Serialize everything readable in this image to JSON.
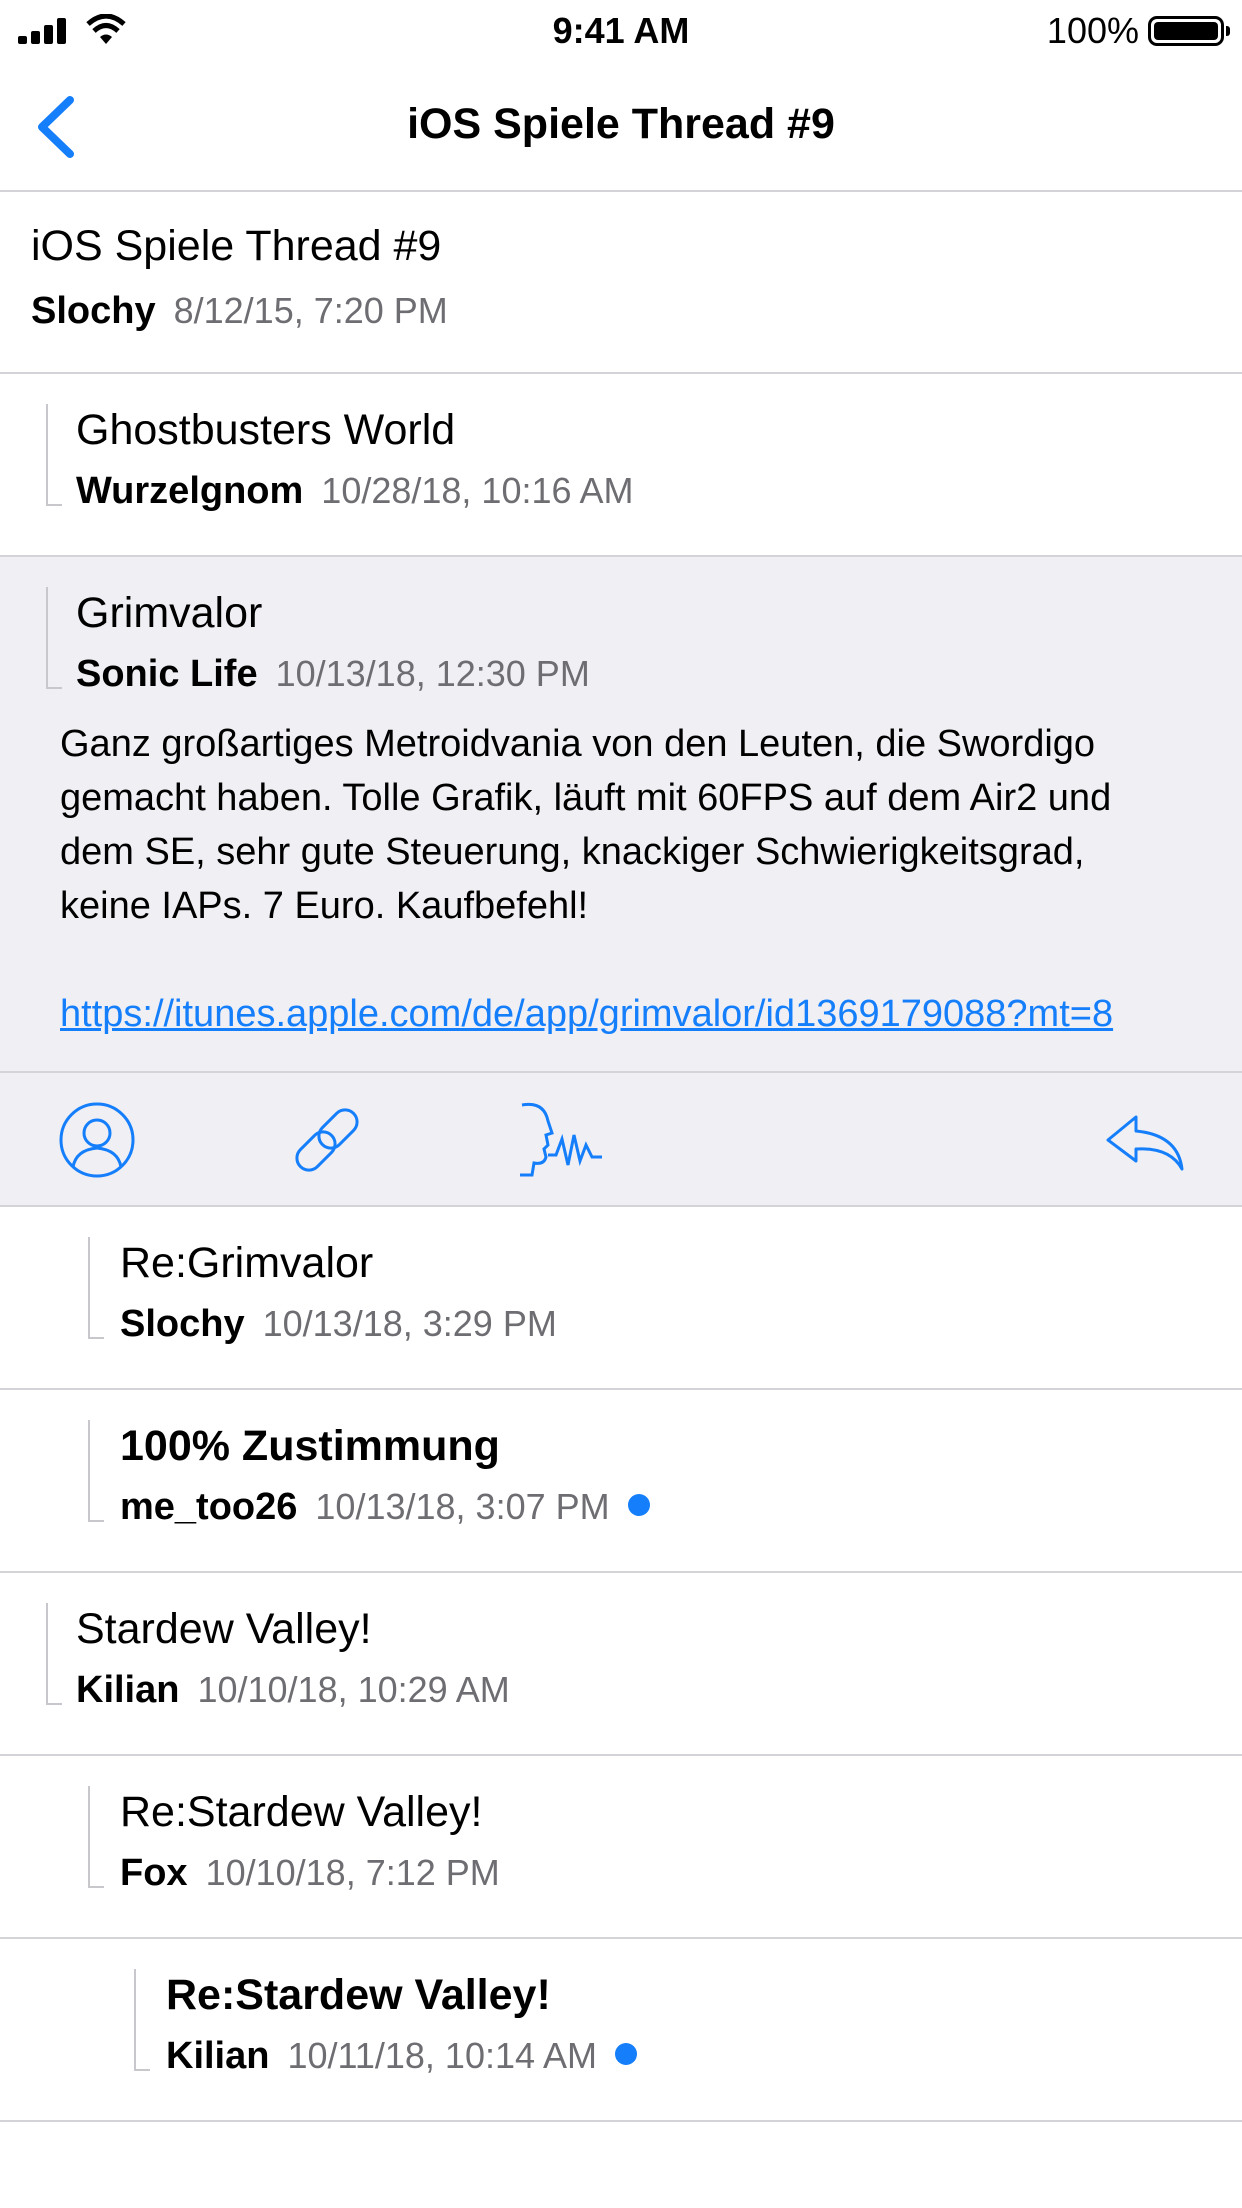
{
  "status_bar": {
    "time": "9:41 AM",
    "battery": "100%"
  },
  "nav": {
    "title": "iOS Spiele Thread #9",
    "back_icon": "chevron-left-icon"
  },
  "colors": {
    "accent": "#147efb",
    "separator": "#d4d4d8",
    "expanded_bg": "#efeff4",
    "secondary_text": "#6d6d72"
  },
  "root_post": {
    "title": "iOS Spiele Thread #9",
    "author": "Slochy",
    "date": "8/12/15, 7:20 PM"
  },
  "posts": [
    {
      "title": "Ghostbusters World",
      "author": "Wurzelgnom",
      "date": "10/28/18, 10:16 AM",
      "unread": false,
      "bold": false
    },
    {
      "title": "Grimvalor",
      "author": "Sonic Life",
      "date": "10/13/18, 12:30 PM",
      "expanded": true
    },
    {
      "title": "Re:Grimvalor",
      "author": "Slochy",
      "date": "10/13/18, 3:29 PM",
      "unread": false,
      "bold": false
    },
    {
      "title": "100% Zustimmung",
      "author": "me_too26",
      "date": "10/13/18, 3:07 PM",
      "unread": true,
      "bold": true
    },
    {
      "title": "Stardew Valley!",
      "author": "Kilian",
      "date": "10/10/18, 10:29 AM",
      "unread": false,
      "bold": false
    },
    {
      "title": "Re:Stardew Valley!",
      "author": "Fox",
      "date": "10/10/18, 7:12 PM",
      "unread": false,
      "bold": false
    },
    {
      "title": "Re:Stardew Valley!",
      "author": "Kilian",
      "date": "10/11/18, 10:14 AM",
      "unread": true,
      "bold": true
    }
  ],
  "expanded_post": {
    "body": "Ganz großartiges Metroidvania von den Leuten, die Swordigo gemacht haben. Tolle Grafik, läuft mit 60FPS auf dem Air2 und dem SE, sehr gute Steuerung, knackiger Schwierigkeitsgrad, keine IAPs. 7 Euro. Kaufbefehl!",
    "link": "https://itunes.apple.com/de/app/grimvalor/id1369179088?mt=8",
    "actions": [
      "profile-icon",
      "link-icon",
      "speak-icon",
      "reply-icon"
    ]
  }
}
